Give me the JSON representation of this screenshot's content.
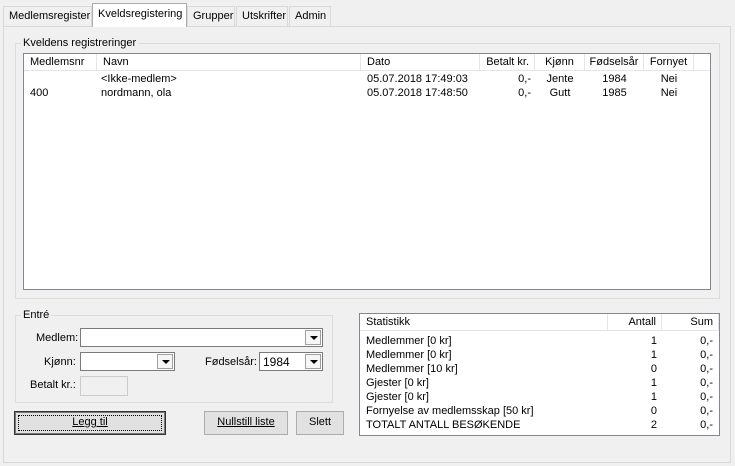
{
  "tabs": [
    {
      "label": "Medlemsregister"
    },
    {
      "label": "Kveldsregistering"
    },
    {
      "label": "Grupper"
    },
    {
      "label": "Utskrifter"
    },
    {
      "label": "Admin"
    }
  ],
  "registrations": {
    "title": "Kveldens registreringer",
    "columns": [
      "Medlemsnr",
      "Navn",
      "Dato",
      "Betalt kr.",
      "Kjønn",
      "Fødselsår",
      "Fornyet"
    ],
    "rows": [
      [
        "",
        "<Ikke-medlem>",
        "05.07.2018 17:49:03",
        "0,-",
        "Jente",
        "1984",
        "Nei"
      ],
      [
        "400",
        "nordmann, ola",
        "05.07.2018 17:48:50",
        "0,-",
        "Gutt",
        "1985",
        "Nei"
      ]
    ]
  },
  "entre": {
    "title": "Entré",
    "member_label": "Medlem:",
    "member_value": "",
    "gender_label": "Kjønn:",
    "gender_value": "",
    "birthyear_label": "Fødselsår:",
    "birthyear_value": "1984",
    "paid_label": "Betalt kr.:",
    "paid_value": ""
  },
  "buttons": {
    "add": "Legg til",
    "reset": "Nullstill liste",
    "delete": "Slett"
  },
  "statistics": {
    "columns": [
      "Statistikk",
      "Antall",
      "Sum"
    ],
    "rows": [
      [
        "Medlemmer [0 kr]",
        "1",
        "0,-"
      ],
      [
        "Medlemmer [0 kr]",
        "1",
        "0,-"
      ],
      [
        "Medlemmer [10 kr]",
        "0",
        "0,-"
      ],
      [
        "Gjester [0 kr]",
        "1",
        "0,-"
      ],
      [
        "Gjester [0 kr]",
        "1",
        "0,-"
      ],
      [
        "Fornyelse av medlemsskap [50 kr]",
        "0",
        "0,-"
      ],
      [
        "TOTALT ANTALL BESØKENDE",
        "2",
        "0,-"
      ]
    ]
  }
}
